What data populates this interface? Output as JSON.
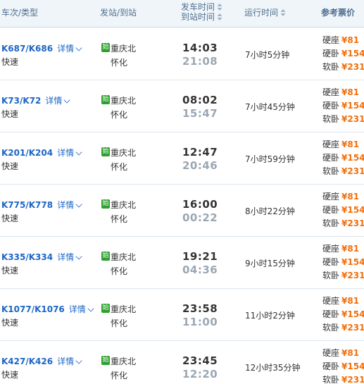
{
  "header": {
    "train_type": "车次/类型",
    "stations": "发站/到站",
    "time_dep": "发车时间",
    "time_arr": "到站时间",
    "duration": "运行时间",
    "price": "参考票价"
  },
  "badge": "始",
  "detail_label": "详情",
  "seat_labels": [
    "硬座",
    "硬卧",
    "软卧"
  ],
  "colors": {
    "train_link": "#1c66c6",
    "price": "#f26f0b",
    "start_badge": "#2fa02f",
    "header_bg": "#f0f5fa"
  },
  "rows": [
    {
      "train": "K687/K686",
      "type": "快速",
      "from": "重庆北",
      "to": "怀化",
      "dep": "14:03",
      "arr": "21:08",
      "duration": "7小时5分钟",
      "prices": [
        "¥81",
        "¥154",
        "¥231"
      ]
    },
    {
      "train": "K73/K72",
      "type": "快速",
      "from": "重庆北",
      "to": "怀化",
      "dep": "08:02",
      "arr": "15:47",
      "duration": "7小时45分钟",
      "prices": [
        "¥81",
        "¥154",
        "¥231"
      ]
    },
    {
      "train": "K201/K204",
      "type": "快速",
      "from": "重庆北",
      "to": "怀化",
      "dep": "12:47",
      "arr": "20:46",
      "duration": "7小时59分钟",
      "prices": [
        "¥81",
        "¥154",
        "¥231"
      ]
    },
    {
      "train": "K775/K778",
      "type": "快速",
      "from": "重庆北",
      "to": "怀化",
      "dep": "16:00",
      "arr": "00:22",
      "duration": "8小时22分钟",
      "prices": [
        "¥81",
        "¥154",
        "¥231"
      ]
    },
    {
      "train": "K335/K334",
      "type": "快速",
      "from": "重庆北",
      "to": "怀化",
      "dep": "19:21",
      "arr": "04:36",
      "duration": "9小时15分钟",
      "prices": [
        "¥81",
        "¥154",
        "¥231"
      ]
    },
    {
      "train": "K1077/K1076",
      "type": "快速",
      "from": "重庆北",
      "to": "怀化",
      "dep": "23:58",
      "arr": "11:00",
      "duration": "11小时2分钟",
      "prices": [
        "¥81",
        "¥154",
        "¥231"
      ]
    },
    {
      "train": "K427/K426",
      "type": "快速",
      "from": "重庆北",
      "to": "怀化",
      "dep": "23:45",
      "arr": "12:20",
      "duration": "12小时35分钟",
      "prices": [
        "¥81",
        "¥154",
        "¥231"
      ]
    }
  ]
}
